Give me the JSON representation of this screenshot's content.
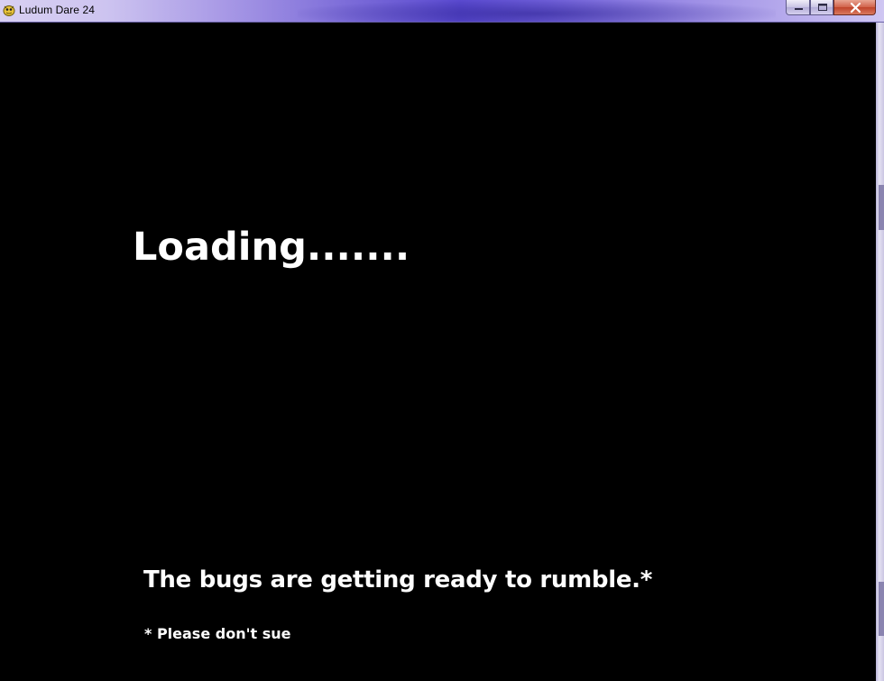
{
  "window": {
    "title": "Ludum Dare 24",
    "icon": "pygame-snake-icon",
    "controls": {
      "minimize": "minimize-icon",
      "maximize": "maximize-icon",
      "close": "close-icon"
    }
  },
  "game": {
    "loading_text": "Loading.......",
    "tagline": "The bugs are getting ready to rumble.*",
    "footnote": "* Please don't sue"
  },
  "colors": {
    "background": "#000000",
    "text": "#ffffff",
    "close_button": "#c0432b"
  }
}
